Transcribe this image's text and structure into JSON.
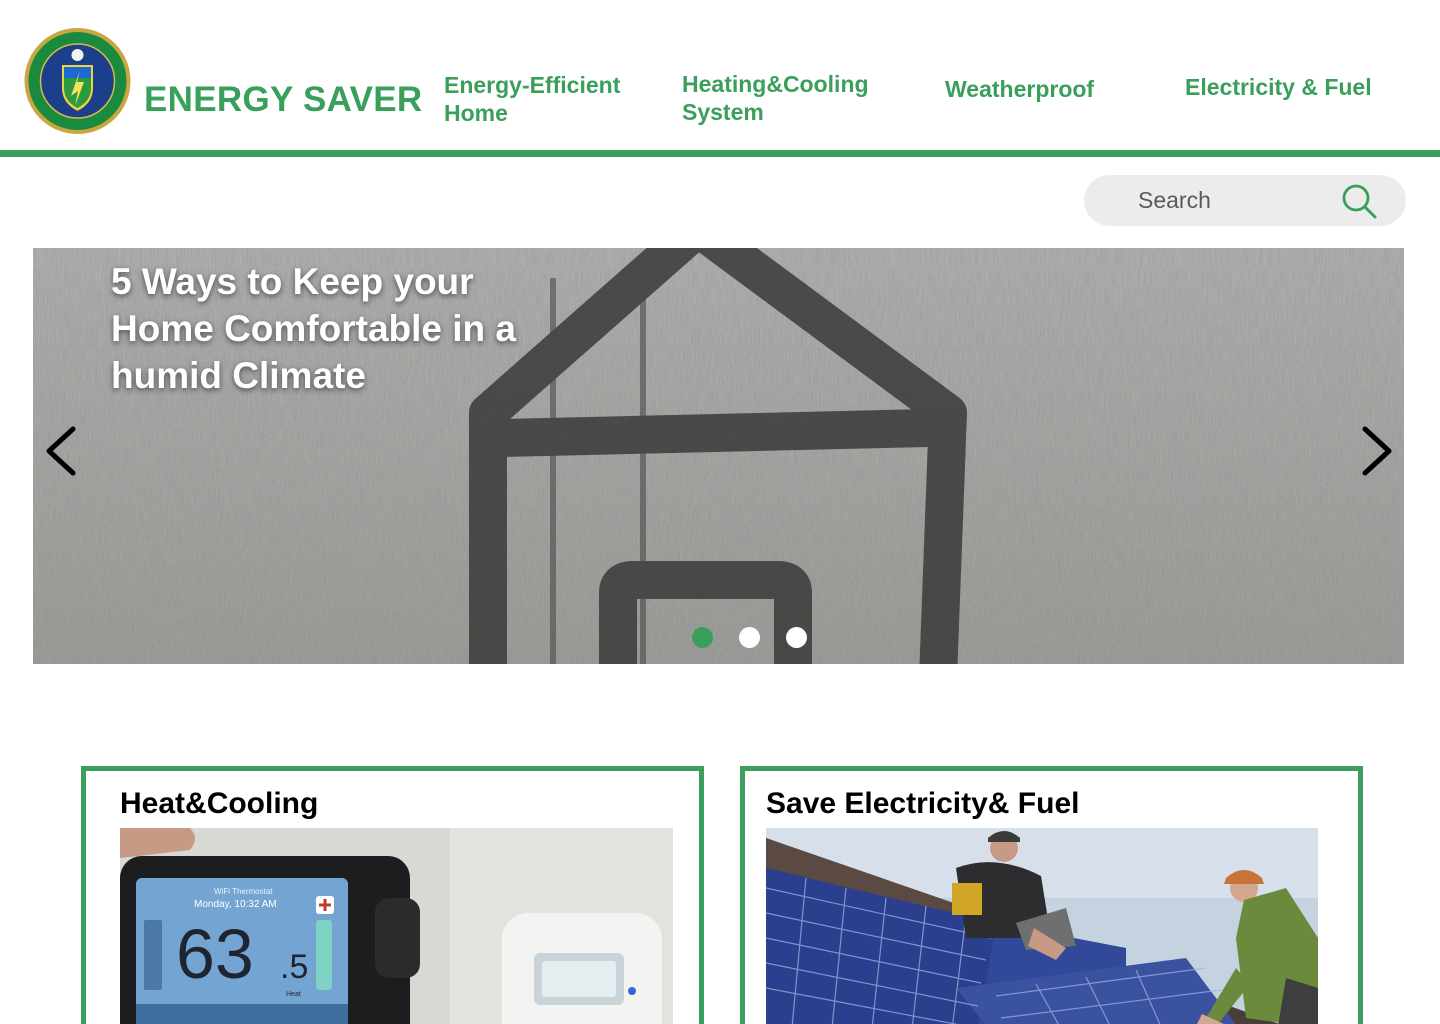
{
  "colors": {
    "brand_green": "#3a9f5b",
    "rule_green": "#3c9e5e",
    "dot_active": "#3a9f5b",
    "dot_inactive": "#ffffff",
    "search_bg": "#ececec"
  },
  "header": {
    "logo_icon": "doe-seal-icon",
    "brand": "ENERGY SAVER",
    "nav": [
      {
        "label": "Energy-Efficient Home"
      },
      {
        "label": "Heating&Cooling System"
      },
      {
        "label": "Weatherproof"
      },
      {
        "label": "Electricity & Fuel"
      }
    ]
  },
  "search": {
    "placeholder": "Search",
    "icon": "search-icon"
  },
  "hero": {
    "title": "5 Ways to Keep your Home Comfortable in a humid Climate",
    "prev_icon": "chevron-left-icon",
    "next_icon": "chevron-right-icon",
    "slides_total": 3,
    "active_slide": 1
  },
  "cards": [
    {
      "title": "Heat&Cooling",
      "image": "thermostat-photo",
      "thermostat_reading": "63.5",
      "thermostat_time": "Monday, 10:32 AM"
    },
    {
      "title": "Save Electricity& Fuel",
      "image": "solar-panel-installers-photo"
    }
  ]
}
